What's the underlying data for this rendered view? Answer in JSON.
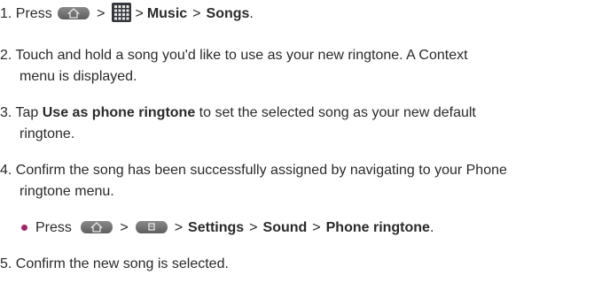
{
  "steps": {
    "s1": {
      "num": "1. Press",
      "gt1": ">",
      "gt2": ">",
      "music": "Music",
      "gt3": ">",
      "songs": "Songs",
      "end": "."
    },
    "s2": {
      "line1": "2. Touch and hold a song you'd like to use as your new ringtone. A Context",
      "line2": "menu is displayed."
    },
    "s3": {
      "pre": "3. Tap ",
      "action": "Use as phone ringtone",
      "post": " to set the selected song as your new default",
      "line2": "ringtone."
    },
    "s4": {
      "line1": "4. Confirm the song has been successfully assigned by navigating to your Phone",
      "line2": "ringtone menu."
    },
    "sub": {
      "press": "Press",
      "gt1": ">",
      "gt2": ">",
      "settings": "Settings",
      "gt3": ">",
      "sound": "Sound",
      "gt4": ">",
      "ringtone": "Phone ringtone",
      "end": "."
    },
    "s5": {
      "text": "5. Confirm the new song is selected."
    }
  },
  "icons": [
    "home-key-icon",
    "applications-grid-icon",
    "menu-key-icon"
  ]
}
